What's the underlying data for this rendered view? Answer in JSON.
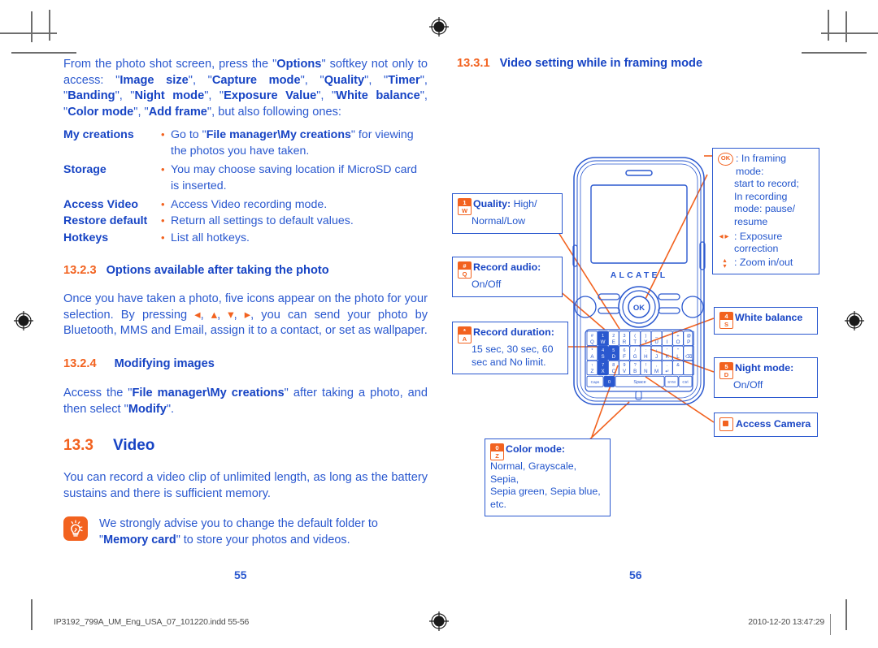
{
  "document": {
    "left_page_number": "55",
    "right_page_number": "56",
    "footer_file": "IP3192_799A_UM_Eng_USA_07_101220.indd   55-56",
    "footer_timestamp": "2010-12-20   13:47:29"
  },
  "colors": {
    "body_blue": "#2a58cf",
    "heading_blue": "#1744c4",
    "accent_orange": "#f2621f",
    "callout_border": "#2a58cf"
  },
  "left_column": {
    "intro_paragraph": "From the photo shot screen, press the \"Options\" softkey not only to access: \"Image size\", \"Capture mode\", \"Quality\", \"Timer\", \"Banding\", \"Night mode\", \"Exposure Value\", \"White balance\", \"Color mode\", \"Add frame\", but also following ones:",
    "options_list": [
      {
        "term": "My creations",
        "desc": "Go to \"File manager\\My creations\" for viewing the photos you have taken."
      },
      {
        "term": "Storage",
        "desc": "You may choose saving location if MicroSD card is inserted."
      },
      {
        "term": "Access Video",
        "desc": "Access Video recording mode."
      },
      {
        "term": "Restore default",
        "desc": "Return all settings to default values."
      },
      {
        "term": "Hotkeys",
        "desc": "List all hotkeys."
      }
    ],
    "section_13_2_3": {
      "number": "13.2.3",
      "title": "Options available after taking the photo"
    },
    "para_13_2_3": "Once you have taken a photo, five icons appear on the photo for your selection. By pressing ◂, ▴, ▾, ▸, you can send your photo by Bluetooth, MMS and Email, assign it to a contact, or set as wallpaper.",
    "section_13_2_4": {
      "number": "13.2.4",
      "title": "Modifying images"
    },
    "para_13_2_4": "Access the \"File manager\\My creations\" after taking a photo, and then select \"Modify\".",
    "section_13_3": {
      "number": "13.3",
      "title": "Video"
    },
    "para_13_3": "You can record a video clip of unlimited length, as long as the battery sustains and there is sufficient memory.",
    "tip": {
      "icon": "lightbulb-tip-icon",
      "text": "We strongly advise you to change the default folder to \"Memory card\" to store your photos and videos."
    }
  },
  "right_column": {
    "section_13_3_1": {
      "number": "13.3.1",
      "title": "Video setting while in framing mode"
    },
    "callouts": [
      {
        "id": "quality",
        "icon": "key-1-w-icon",
        "icon_upper": "1",
        "icon_lower": "W",
        "label": "Quality:",
        "value": "High/ Normal/Low"
      },
      {
        "id": "record-audio",
        "icon": "key-star-a-icon",
        "icon_upper": "#",
        "icon_lower": "Q",
        "label": "Record audio:",
        "value": "On/Off"
      },
      {
        "id": "record-duration",
        "icon": "key-star-a-icon",
        "icon_upper": "*",
        "icon_lower": "A",
        "label": "Record duration:",
        "value": "15 sec, 30 sec, 60 sec and No limit."
      },
      {
        "id": "color-mode",
        "icon": "key-0-z-icon",
        "icon_upper": "0",
        "icon_lower": "Z",
        "label": "Color mode:",
        "value": "Normal, Grayscale, Sepia, Sepia green, Sepia blue, etc."
      },
      {
        "id": "white-balance",
        "icon": "key-4-s-icon",
        "icon_upper": "4",
        "icon_lower": "S",
        "label": "White balance",
        "value": ""
      },
      {
        "id": "night-mode",
        "icon": "key-5-d-icon",
        "icon_upper": "5",
        "icon_lower": "D",
        "label": "Night mode:",
        "value": "On/Off"
      },
      {
        "id": "access-camera",
        "icon": "camera-key-icon",
        "label": "Access Camera",
        "value": ""
      }
    ],
    "framing_callout": {
      "ok_icon": "ok-key-icon",
      "ok_text": ": In framing mode: start to record; In recording mode: pause/ resume",
      "lr_icon": "left-right-arrow-icon",
      "lr_text": ": Exposure correction",
      "ud_icon": "up-down-arrow-icon",
      "ud_text": ": Zoom in/out"
    }
  },
  "phone": {
    "brand": "ALCATEL",
    "ok_key_label": "OK",
    "keyboard": {
      "row1_top": [
        "#",
        "1",
        "2",
        "3",
        "(",
        ")",
        "_",
        "-",
        "+",
        "@"
      ],
      "row1_bot": [
        "Q",
        "W",
        "E",
        "R",
        "T",
        "Y",
        "U",
        "I",
        "O",
        "P"
      ],
      "row2_top": [
        "*",
        "4",
        "5",
        "6",
        "/",
        ":",
        "¡",
        "'",
        "\"",
        ""
      ],
      "row2_bot": [
        "A",
        "S",
        "D",
        "F",
        "G",
        "H",
        "J",
        "K",
        "L",
        "⌫"
      ],
      "row3_top": [
        "↑",
        "7",
        "8",
        "9",
        "?",
        "!",
        ",",
        ".",
        "&",
        ""
      ],
      "row3_bot": [
        "Z",
        "X",
        "C",
        "V",
        "B",
        "N",
        "M",
        "↵"
      ],
      "bottom_row": [
        "Caps",
        "0",
        "Space",
        "SYM",
        "Ctrl"
      ]
    }
  }
}
